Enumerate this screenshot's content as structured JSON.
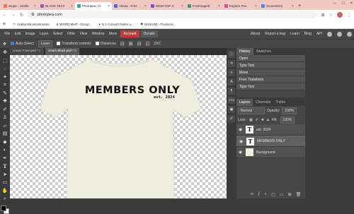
{
  "browser": {
    "tabs": [
      {
        "label": "Stope - Untitle",
        "color": "#e07b5a"
      },
      {
        "label": "BLANK TEXT",
        "color": "#9b59b6"
      },
      {
        "label": "Photopea | O",
        "color": "#2aa7a3"
      },
      {
        "label": "Alinaa - Free",
        "color": "#4a6cd4"
      },
      {
        "label": "DESKTOP S",
        "color": "#7d4fd1"
      },
      {
        "label": "Freemage/K",
        "color": "#3c9e6a"
      },
      {
        "label": "Explore Pos",
        "color": "#d94f8a"
      },
      {
        "label": "Screenshot",
        "color": "#4a8ad4"
      }
    ],
    "active_tab": 2,
    "url": "photopea.com",
    "bookmarks": [
      "Arabia Mtn Bookmarks",
      "WORD MAP - Googl...",
      "N.1 Convert Rates a...",
      "UNILUMI - Products..."
    ]
  },
  "menu": {
    "items": [
      "File",
      "Edit",
      "Image",
      "Layer",
      "Select",
      "Filter",
      "View",
      "Window",
      "More"
    ],
    "account": "Account",
    "donate": "Donate",
    "right": [
      "About",
      "Report a bug",
      "Learn",
      "Blog",
      "API"
    ]
  },
  "options": {
    "auto_select": "Auto-Select",
    "layer_select": "Layer",
    "transform_controls": "Transform controls",
    "distances": "Distances",
    "zoom_label": "2XC"
  },
  "documents": {
    "tabs": [
      "cream Front.psd *",
      "cream Black.psd *"
    ]
  },
  "shirt": {
    "title": "MEMBERS ONLY",
    "subtitle": "est. 2024",
    "color": "#efeede"
  },
  "history": {
    "tabs": [
      "History",
      "Swatches"
    ],
    "items": [
      "Open",
      "Type Tool",
      "Move",
      "Free Transform",
      "Type Tool"
    ]
  },
  "layers": {
    "tabs": [
      "Layers",
      "Channels",
      "Paths"
    ],
    "blend_mode": "Normal",
    "opacity_label": "Opacity:",
    "opacity_value": "100%",
    "lock_label": "Lock:",
    "fill_label": "Fill:",
    "fill_value": "100%",
    "items": [
      {
        "name": "est. 2024",
        "thumb": "T"
      },
      {
        "name": "MEMBERS ONLY",
        "thumb": "T"
      },
      {
        "name": "Background",
        "thumb": ""
      }
    ]
  }
}
